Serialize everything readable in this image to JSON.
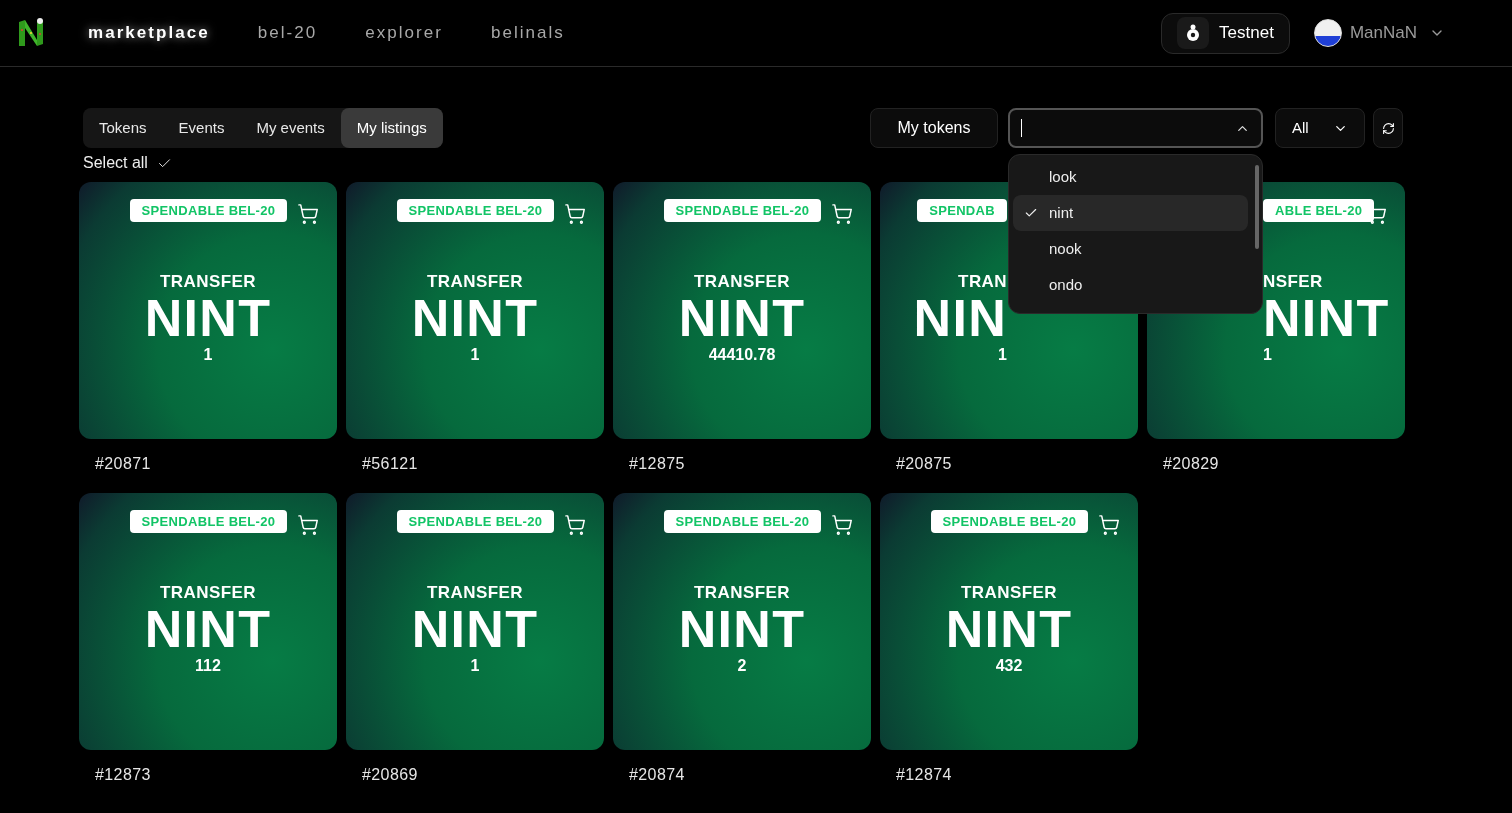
{
  "header": {
    "nav": [
      {
        "label": "marketplace",
        "selected": true
      },
      {
        "label": "bel-20",
        "selected": false
      },
      {
        "label": "explorer",
        "selected": false
      },
      {
        "label": "belinals",
        "selected": false
      }
    ],
    "network": {
      "label": "Testnet"
    },
    "user": {
      "name": "ManNaN"
    }
  },
  "tabs": [
    {
      "label": "Tokens",
      "selected": false
    },
    {
      "label": "Events",
      "selected": false
    },
    {
      "label": "My events",
      "selected": false
    },
    {
      "label": "My listings",
      "selected": true
    }
  ],
  "select_all": {
    "label": "Select all"
  },
  "toolbar": {
    "my_tokens": "My tokens",
    "ticker_select": {
      "expanded": true,
      "options": [
        {
          "label": "look",
          "selected": false
        },
        {
          "label": "nint",
          "selected": true
        },
        {
          "label": "nook",
          "selected": false
        },
        {
          "label": "ondo",
          "selected": false
        }
      ]
    },
    "filter": "All"
  },
  "cards": [
    {
      "badge": "SPENDABLE BEL-20",
      "action": "TRANSFER",
      "ticker": "NINT",
      "amount": "1",
      "number": "#20871",
      "cart": true
    },
    {
      "badge": "SPENDABLE BEL-20",
      "action": "TRANSFER",
      "ticker": "NINT",
      "amount": "1",
      "number": "#56121",
      "cart": true
    },
    {
      "badge": "SPENDABLE BEL-20",
      "action": "TRANSFER",
      "ticker": "NINT",
      "amount": "44410.78",
      "number": "#12875",
      "cart": true
    },
    {
      "badge": "SPENDAB",
      "action": "TRAN",
      "ticker": "NIN",
      "amount": "1",
      "number": "#20875",
      "cart": false,
      "kind": "leftpart"
    },
    {
      "badge": "ABLE BEL-20",
      "action": "NSFER",
      "ticker": "NINT",
      "amount": "1",
      "number": "#20829",
      "cart": true,
      "kind": "rightpart"
    },
    {
      "badge": "SPENDABLE BEL-20",
      "action": "TRANSFER",
      "ticker": "NINT",
      "amount": "112",
      "number": "#12873",
      "cart": true
    },
    {
      "badge": "SPENDABLE BEL-20",
      "action": "TRANSFER",
      "ticker": "NINT",
      "amount": "1",
      "number": "#20869",
      "cart": true
    },
    {
      "badge": "SPENDABLE BEL-20",
      "action": "TRANSFER",
      "ticker": "NINT",
      "amount": "2",
      "number": "#20874",
      "cart": true
    },
    {
      "badge": "SPENDABLE BEL-20",
      "action": "TRANSFER",
      "ticker": "NINT",
      "amount": "432",
      "number": "#12874",
      "cart": true
    }
  ]
}
